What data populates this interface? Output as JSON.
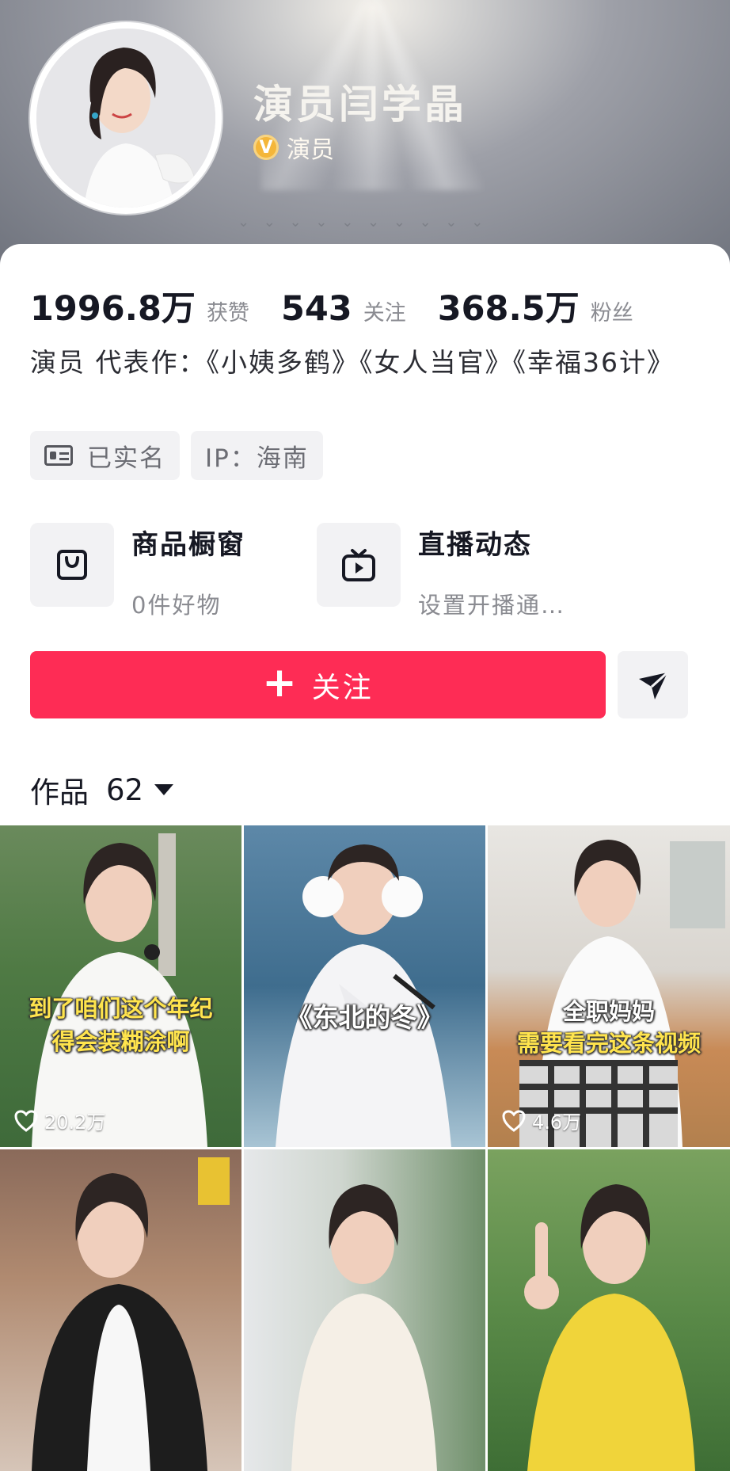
{
  "profile": {
    "name": "演员闫学晶",
    "verified_label": "演员",
    "verified_badge": "V"
  },
  "stats": [
    {
      "value": "1996.8万",
      "label": "获赞"
    },
    {
      "value": "543",
      "label": "关注"
    },
    {
      "value": "368.5万",
      "label": "粉丝"
    }
  ],
  "bio": "演员 代表作：《小姨多鹤》《女人当官》《幸福36计》",
  "tags": {
    "realname": "已实名",
    "ip": "IP：海南"
  },
  "features": [
    {
      "title": "商品橱窗",
      "sub": "0件好物",
      "icon": "shopping-bag-icon"
    },
    {
      "title": "直播动态",
      "sub": "设置开播通…",
      "icon": "tv-icon"
    }
  ],
  "follow_button": {
    "label": "关注"
  },
  "works": {
    "label": "作品",
    "count": "62"
  },
  "videos": [
    {
      "caption": "到了咱们这个年纪\n得会装糊涂啊",
      "likes": "20.2万"
    },
    {
      "caption": "《东北的冬》",
      "likes": ""
    },
    {
      "caption": "全职妈妈\n需要看完这条视频",
      "likes": "4.6万"
    },
    {
      "caption": "",
      "likes": ""
    },
    {
      "caption": "",
      "likes": ""
    },
    {
      "caption": "",
      "likes": ""
    }
  ],
  "colors": {
    "accent": "#fe2c55",
    "badge": "#f4b63a"
  }
}
